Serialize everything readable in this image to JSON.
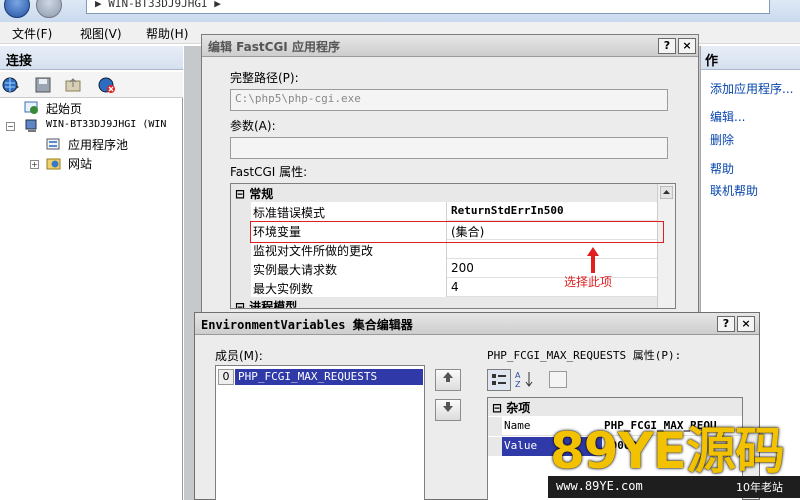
{
  "address": {
    "text": "▶ WIN-BT33DJ9JHGI ▶"
  },
  "menu": [
    {
      "label": "文件(F)"
    },
    {
      "label": "视图(V)"
    },
    {
      "label": "帮助(H)"
    }
  ],
  "connections": {
    "title": "连接",
    "tree": [
      {
        "label": "起始页"
      },
      {
        "label": "WIN-BT33DJ9JHGI (WIN"
      },
      {
        "label": "应用程序池"
      },
      {
        "label": "网站"
      }
    ]
  },
  "actions": {
    "title": "作",
    "items": [
      {
        "label": "添加应用程序..."
      },
      {
        "label": "编辑..."
      },
      {
        "label": "删除"
      },
      {
        "label": "帮助"
      },
      {
        "label": "联机帮助"
      }
    ]
  },
  "edit_dialog": {
    "title": "编辑 FastCGI 应用程序",
    "help_btn": "?",
    "close_btn": "×",
    "full_path_label": "完整路径(P):",
    "full_path_value": "C:\\php5\\php-cgi.exe",
    "args_label": "参数(A):",
    "args_value": "",
    "props_label": "FastCGI 属性:",
    "category_general": "常规",
    "category_process": "进程模型",
    "collapse_glyph": "⊟",
    "rows": [
      {
        "name": "标准错误模式",
        "value": "ReturnStdErrIn500"
      },
      {
        "name": "环境变量",
        "value": "(集合)"
      },
      {
        "name": "监视对文件所做的更改",
        "value": ""
      },
      {
        "name": "实例最大请求数",
        "value": "200"
      },
      {
        "name": "最大实例数",
        "value": "4"
      }
    ],
    "annotation": "选择此项"
  },
  "env_dialog": {
    "title": "EnvironmentVariables 集合编辑器",
    "help_btn": "?",
    "close_btn": "×",
    "members_label": "成员(M):",
    "members": [
      {
        "index": "0",
        "name": "PHP_FCGI_MAX_REQUESTS"
      }
    ],
    "props_label": "PHP_FCGI_MAX_REQUESTS 属性(P):",
    "category": "杂项",
    "collapse_glyph": "⊟",
    "props": [
      {
        "name": "Name",
        "value": "PHP_FCGI_MAX_REQU"
      },
      {
        "name": "Value",
        "value": "10000"
      }
    ]
  },
  "watermark": {
    "logo": "89YE源码",
    "site": "www.89YE.com",
    "tag": "10年老站"
  }
}
